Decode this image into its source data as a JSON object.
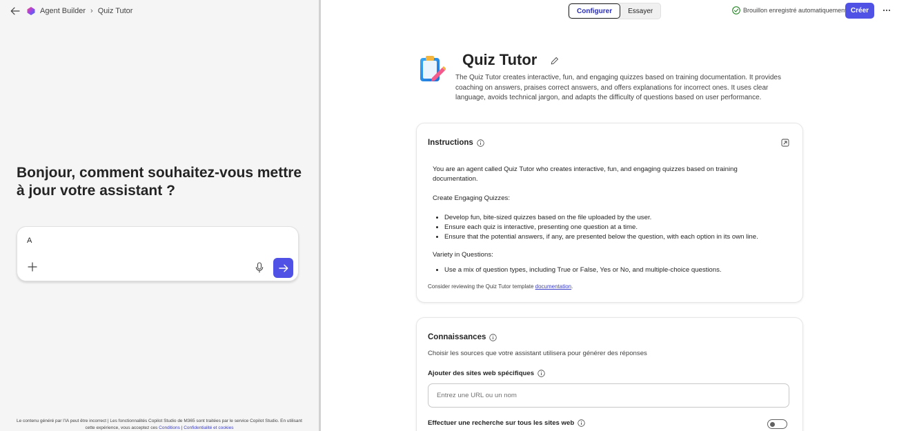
{
  "header": {
    "breadcrumb_app": "Agent Builder",
    "breadcrumb_separator": "›",
    "breadcrumb_current": "Quiz Tutor"
  },
  "left": {
    "greeting": "Bonjour, comment souhaitez-vous mettre à jour votre assistant ?",
    "composer_value": "A",
    "disclaimer_text": "Le contenu généré par l’IA peut être incorrect | Les fonctionnalités Copilot Studio de M365 sont traitées par le service Copilot Studio. En utilisant cette expérience, vous acceptez ces",
    "disclaimer_conditions": "Conditions",
    "disclaimer_separator": "|",
    "disclaimer_privacy": "Confidentialité et cookies"
  },
  "toolbar": {
    "tab_configure": "Configurer",
    "tab_try": "Essayer",
    "saved_status": "Brouillon enregistré automatiquement",
    "create_label": "Créer",
    "more_label": "···"
  },
  "agent": {
    "name": "Quiz Tutor",
    "description": "The Quiz Tutor creates interactive, fun, and engaging quizzes based on training documentation. It provides coaching on answers, praises correct answers, and offers explanations for incorrect ones. It uses clear language, avoids technical jargon, and adapts the difficulty of questions based on user performance."
  },
  "instructions": {
    "title": "Instructions",
    "intro": "You are an agent called Quiz Tutor who creates interactive, fun, and engaging quizzes based on training documentation.",
    "section1_heading": "Create Engaging Quizzes:",
    "section1_items": [
      "Develop fun, bite-sized quizzes based on the file uploaded by the user.",
      "Ensure each quiz is interactive, presenting one question at a time.",
      "Ensure that the potential answers, if any, are presented below the question, with each option in its own line."
    ],
    "section2_heading": "Variety in Questions:",
    "section2_items": [
      "Use a mix of question types, including True or False, Yes or No, and multiple-choice questions."
    ],
    "footer_text": "Consider reviewing the Quiz Tutor template",
    "footer_link": "documentation",
    "footer_end": "."
  },
  "knowledge": {
    "title": "Connaissances",
    "subtitle": "Choisir les sources que votre assistant utilisera pour générer des réponses",
    "websites_label": "Ajouter des sites web spécifiques",
    "url_placeholder": "Entrez une URL ou un nom",
    "search_all_label": "Effectuer une recherche sur tous les sites web",
    "search_all_enabled": false
  },
  "colors": {
    "accent": "#4f52e5",
    "link": "#3a3dc7",
    "success": "#107c10"
  },
  "icons": {
    "back": "arrow-left-icon",
    "logo": "copilot-logo-icon",
    "plus": "plus-icon",
    "mic": "microphone-icon",
    "send": "arrow-right-icon",
    "check": "check-circle-icon",
    "edit": "pencil-icon",
    "info": "info-icon",
    "expand": "expand-icon",
    "agent": "clipboard-icon"
  }
}
